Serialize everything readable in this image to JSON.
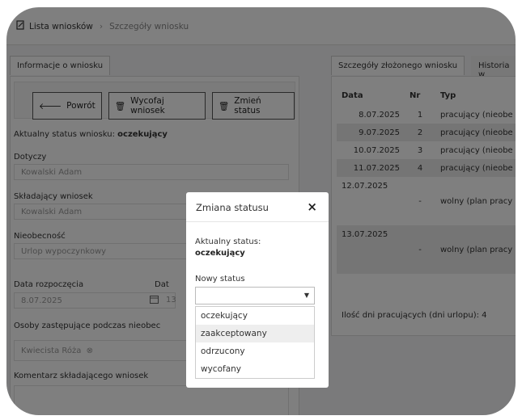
{
  "breadcrumb": {
    "root": "Lista wniosków",
    "current": "Szczegóły wniosku"
  },
  "left_panel": {
    "tab": "Informacje o wniosku",
    "buttons": {
      "back": "Powrót",
      "withdraw": "Wycofaj wniosek",
      "change_status": "Zmień status"
    },
    "status_label": "Aktualny status wniosku:",
    "status_value": "oczekujący",
    "fields": {
      "dotyczy_label": "Dotyczy",
      "dotyczy_value": "Kowalski Adam",
      "skladajacy_label": "Składający wniosek",
      "skladajacy_value": "Kowalski Adam",
      "nieobecnosc_label": "Nieobecność",
      "nieobecnosc_value": "Urlop wypoczynkowy",
      "data_start_label": "Data rozpoczęcia",
      "data_start_value": "8.07.2025",
      "data_end_label": "Dat",
      "data_end_value": "13",
      "osoby_label": "Osoby zastępujące podczas nieobec",
      "osoba_tag": "Kwiecista Róża",
      "komentarz_label": "Komentarz składającego wniosek"
    }
  },
  "right_panel": {
    "tabs": [
      "Szczegóły złożonego wniosku",
      "Historia w"
    ],
    "columns": [
      "Data",
      "Nr",
      "Typ"
    ],
    "rows": [
      {
        "date": "8.07.2025",
        "nr": "1",
        "typ": "pracujący (nieobe"
      },
      {
        "date": "9.07.2025",
        "nr": "2",
        "typ": "pracujący (nieobe"
      },
      {
        "date": "10.07.2025",
        "nr": "3",
        "typ": "pracujący (nieobe"
      },
      {
        "date": "11.07.2025",
        "nr": "4",
        "typ": "pracujący (nieobe"
      },
      {
        "date": "12.07.2025",
        "nr": "-",
        "typ": "wolny (plan pracy"
      },
      {
        "date": "13.07.2025",
        "nr": "-",
        "typ": "wolny (plan pracy"
      }
    ],
    "summary": "Ilość dni pracujących (dni urlopu): 4"
  },
  "modal": {
    "title": "Zmiana statusu",
    "close": "×",
    "current_label": "Aktualny status:",
    "current_value": "oczekujący",
    "new_label": "Nowy status",
    "options": [
      "oczekujący",
      "zaakceptowany",
      "odrzucony",
      "wycofany"
    ],
    "highlighted": "zaakceptowany"
  }
}
